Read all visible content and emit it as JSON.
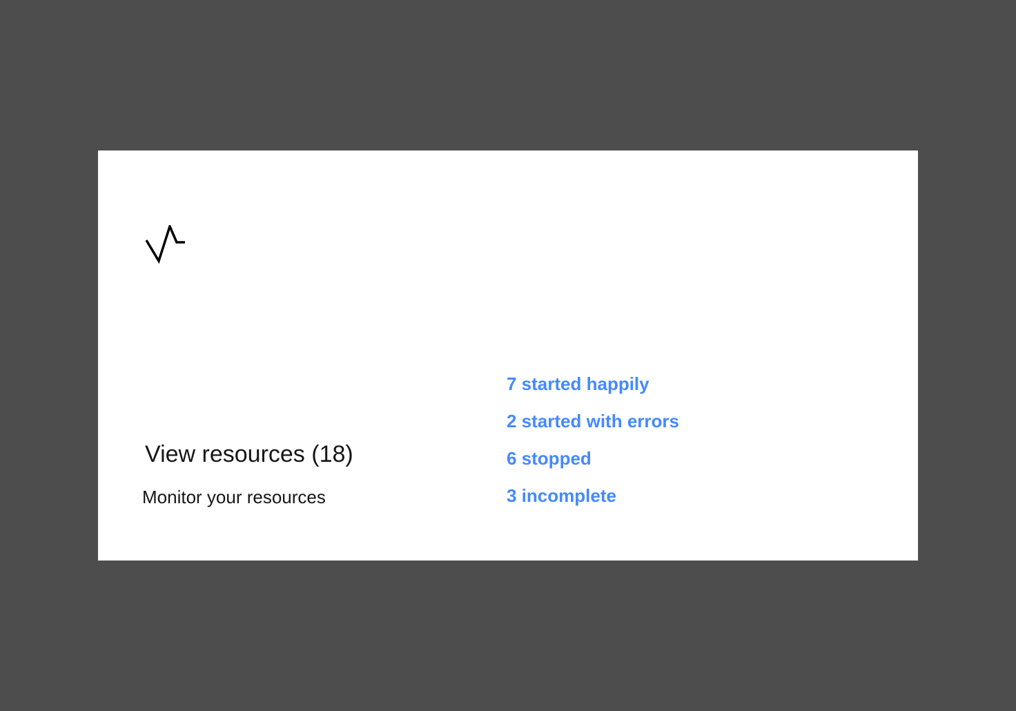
{
  "card": {
    "icon": "activity-icon",
    "title": "View resources (18)",
    "subtitle": "Monitor your resources",
    "link_color": "#4589ff",
    "status_links": [
      {
        "label": "7 started happily"
      },
      {
        "label": "2 started with errors"
      },
      {
        "label": "6 stopped"
      },
      {
        "label": "3 incomplete"
      }
    ]
  }
}
